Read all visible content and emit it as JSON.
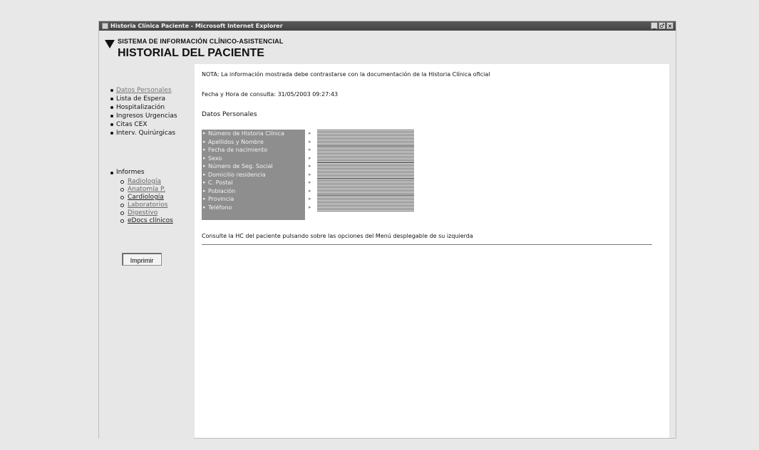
{
  "window": {
    "title": "Historia Clínica Paciente - Microsoft Internet Explorer",
    "controls": [
      "_",
      "♂",
      "×"
    ]
  },
  "header": {
    "system": "SISTEMA DE INFORMACIÓN CLÍNICO-ASISTENCIAL",
    "title": "HISTORIAL DEL PACIENTE"
  },
  "sidebar": {
    "menu": [
      "Datos Personales",
      "Lista de Espera",
      "Hospitalización",
      "Ingresos Urgencias",
      "Citas CEX",
      "Interv. Quirúrgicas"
    ],
    "informes_label": "Informes",
    "informes": [
      "Radiología",
      "Anatomía P.",
      "Cardiología",
      "Laboratorios",
      "Digestivo",
      "eDocs clínicos"
    ],
    "print_label": "Imprimir"
  },
  "main": {
    "nota": "NOTA: La información mostrada debe contrastarse con la documentación de la Historia Clínica oficial",
    "fecha": "Fecha y Hora de consulta: 31/05/2003 09:27:43",
    "section_title": "Datos Personales",
    "fields": [
      "Número de Historia Clínica",
      "Apellidos y Nombre",
      "Fecha de nacimiento",
      "Sexo",
      "Número de Seg. Social",
      "Domicilio residencia",
      "C. Postal",
      "Población",
      "Provincia",
      "Teléfono"
    ],
    "arrow_symbol": "▸",
    "footer": "Consulte la HC del paciente pulsando sobre las opciones del Menú desplegable de su izquierda"
  }
}
